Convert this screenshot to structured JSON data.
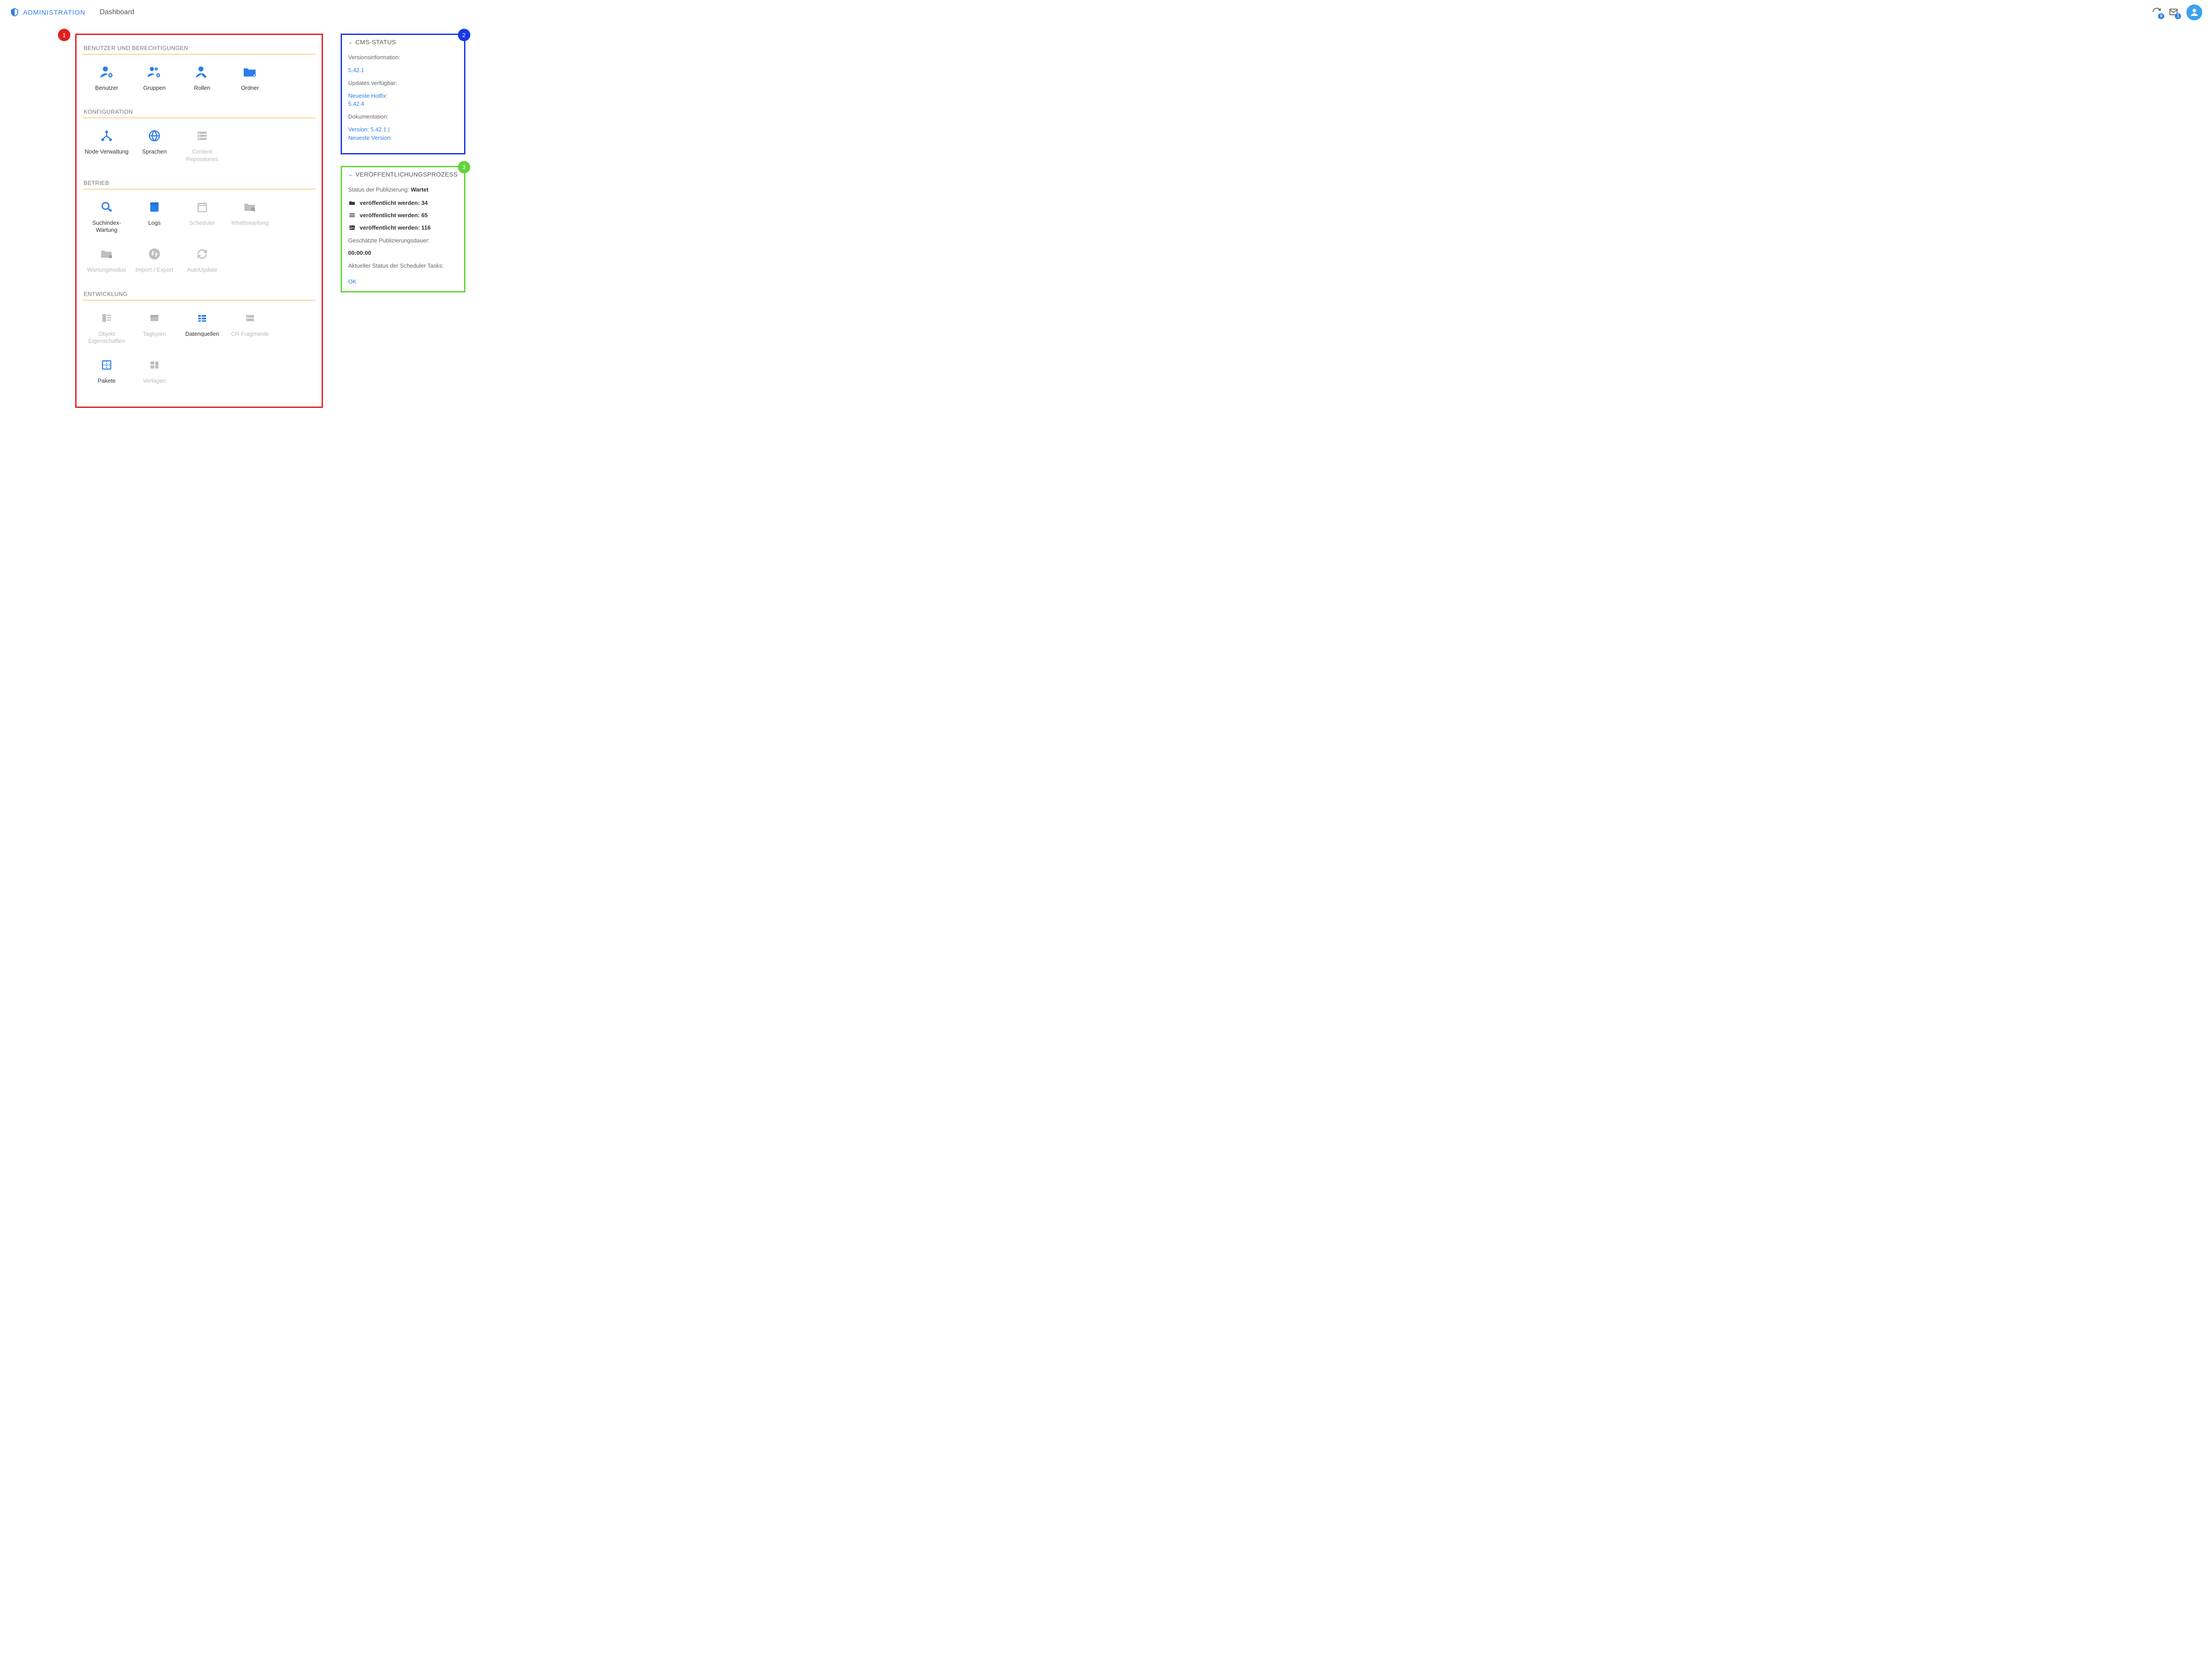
{
  "header": {
    "app_name": "ADMINISTRATION",
    "page_title": "Dashboard",
    "refresh_badge": "0",
    "mail_badge": "1"
  },
  "callouts": {
    "one": "1",
    "two": "2",
    "three": "3"
  },
  "sections": {
    "users": {
      "title": "BENUTZER UND BERECHTIGUNGEN",
      "items": {
        "benutzer": "Benutzer",
        "gruppen": "Gruppen",
        "rollen": "Rollen",
        "ordner": "Ordner"
      }
    },
    "config": {
      "title": "KONFIGURATION",
      "items": {
        "node": "Node Verwaltung",
        "sprachen": "Sprachen",
        "contentrepo": "Content Repositories"
      }
    },
    "betrieb": {
      "title": "BETRIEB",
      "items": {
        "suchindex": "Suchindex-Wartung",
        "logs": "Logs",
        "scheduler": "Scheduler",
        "inhalt": "Inhaltswartung",
        "wartung": "Wartungmodus",
        "import": "Import / Export",
        "autoupdate": "AutoUpdate"
      }
    },
    "entw": {
      "title": "ENTWICKLUNG",
      "items": {
        "objekt": "Objekt Eigenschaften",
        "tagtypen": "Tagtypen",
        "datenquellen": "Datenquellen",
        "crfrag": "CR Fragmente",
        "pakete": "Pakete",
        "vorlagen": "Vorlagen"
      }
    }
  },
  "cms": {
    "title": "CMS-STATUS",
    "version_label": "Versionsinformation:",
    "version": "5.42.1",
    "updates_label": "Updates verfügbar:",
    "hotfix_label": "Neueste Hotfix:",
    "hotfix_version": "5.42.4",
    "doc_label": "Dokumentation:",
    "doc_version_link": "Version: 5.42.1",
    "doc_sep": " | ",
    "doc_latest": "Neueste Version"
  },
  "pub": {
    "title": "VERÖFFENTLICHUNGSPROZESS",
    "status_label": "Status der Publizierung: ",
    "status_value": "Wartet",
    "folder_label": "veröffentlicht werden: 34",
    "page_label": "veröffentlicht werden: 65",
    "image_label": "veröffentlicht werden: 116",
    "est_label": "Geschätzte Publizierungsdauer:",
    "est_value": "00:00:00",
    "sched_label": "Aktueller Status der Scheduler Tasks:",
    "ok": "OK"
  }
}
